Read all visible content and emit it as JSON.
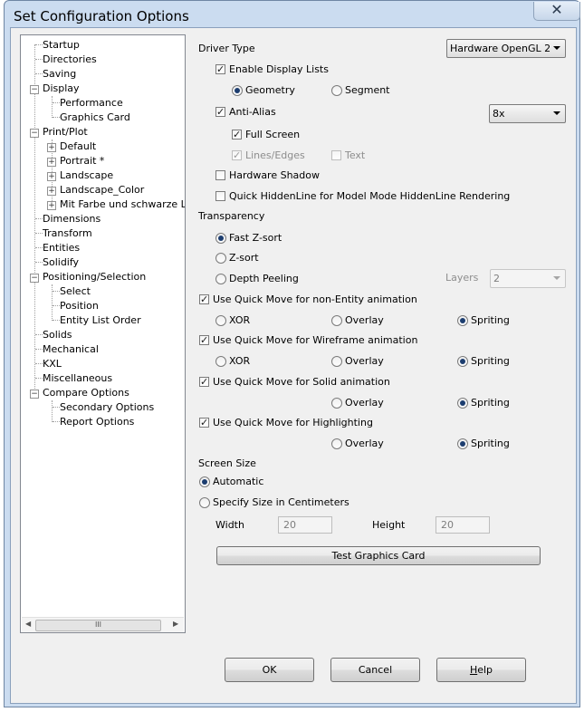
{
  "window": {
    "title": "Set Configuration Options",
    "close_glyph": "✕"
  },
  "tree": {
    "items": [
      {
        "label": "Startup"
      },
      {
        "label": "Directories"
      },
      {
        "label": "Saving"
      },
      {
        "label": "Display"
      },
      {
        "label": "Performance"
      },
      {
        "label": "Graphics Card"
      },
      {
        "label": "Print/Plot"
      },
      {
        "label": "Default"
      },
      {
        "label": "Portrait *"
      },
      {
        "label": "Landscape"
      },
      {
        "label": "Landscape_Color"
      },
      {
        "label": "Mit Farbe und schwarze Linie"
      },
      {
        "label": "Dimensions"
      },
      {
        "label": "Transform"
      },
      {
        "label": "Entities"
      },
      {
        "label": "Solidify"
      },
      {
        "label": "Positioning/Selection"
      },
      {
        "label": "Select"
      },
      {
        "label": "Position"
      },
      {
        "label": "Entity List Order"
      },
      {
        "label": "Solids"
      },
      {
        "label": "Mechanical"
      },
      {
        "label": "KXL"
      },
      {
        "label": "Miscellaneous"
      },
      {
        "label": "Compare Options"
      },
      {
        "label": "Secondary Options"
      },
      {
        "label": "Report Options"
      }
    ],
    "scroll_grip": "III",
    "scroll_left": "◀",
    "scroll_right": "▶",
    "expander_minus": "−",
    "expander_plus": "+"
  },
  "driver": {
    "label": "Driver Type",
    "value": "Hardware OpenGL 2",
    "enable_display_lists": "Enable Display Lists",
    "geometry": "Geometry",
    "segment": "Segment",
    "anti_alias": "Anti-Alias",
    "anti_alias_value": "8x",
    "full_screen": "Full Screen",
    "lines_edges": "Lines/Edges",
    "text": "Text",
    "hardware_shadow": "Hardware Shadow",
    "quick_hiddenline": "Quick HiddenLine for Model Mode HiddenLine Rendering",
    "check_mark": "✓"
  },
  "transparency": {
    "label": "Transparency",
    "fast_zsort": "Fast Z-sort",
    "zsort": "Z-sort",
    "depth_peeling": "Depth Peeling",
    "layers_label": "Layers",
    "layers_value": "2"
  },
  "quickmove": {
    "non_entity": "Use Quick Move for non-Entity animation",
    "wireframe": "Use Quick Move for Wireframe animation",
    "solid": "Use Quick Move for Solid animation",
    "highlighting": "Use Quick Move for Highlighting",
    "xor": "XOR",
    "overlay": "Overlay",
    "spriting": "Spriting"
  },
  "screen": {
    "label": "Screen Size",
    "automatic": "Automatic",
    "specify": "Specify Size in Centimeters",
    "width_label": "Width",
    "width_value": "20",
    "height_label": "Height",
    "height_value": "20"
  },
  "buttons": {
    "test": "Test Graphics Card",
    "ok": "OK",
    "cancel": "Cancel",
    "help_first": "H",
    "help_rest": "elp"
  }
}
